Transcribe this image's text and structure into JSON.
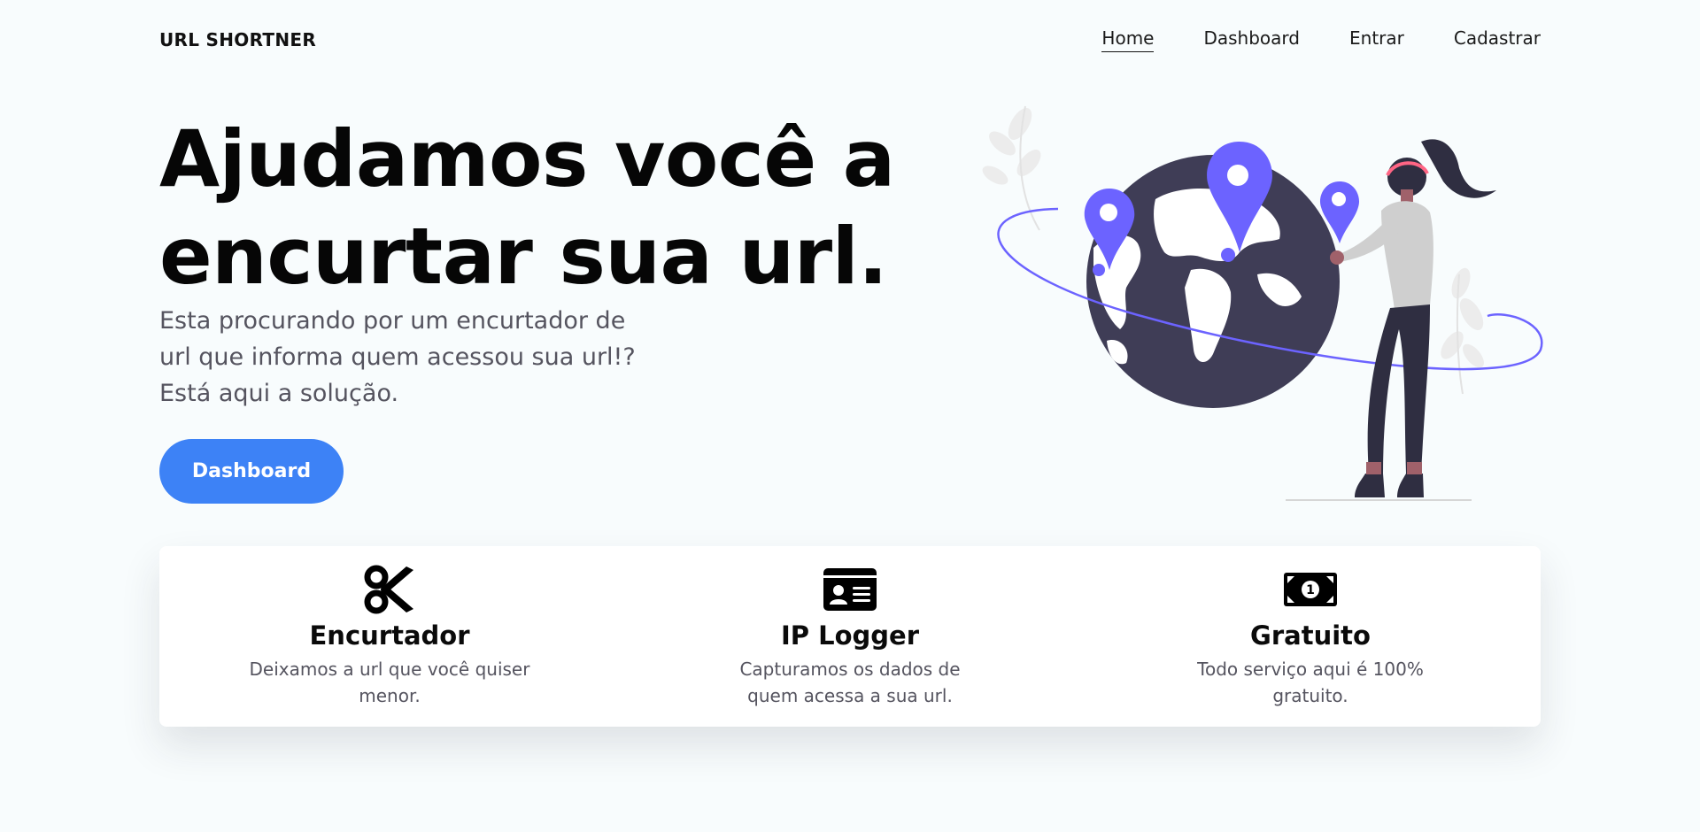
{
  "nav": {
    "brand": "URL SHORTNER",
    "links": [
      {
        "label": "Home",
        "active": true
      },
      {
        "label": "Dashboard"
      },
      {
        "label": "Entrar"
      },
      {
        "label": "Cadastrar"
      }
    ]
  },
  "hero": {
    "title_line1": "Ajudamos você a",
    "title_line2": "encurtar sua url.",
    "sub_line1": "Esta procurando por um encurtador de",
    "sub_line2": "url que informa quem acessou sua url!?",
    "sub_line3": "Está aqui a solução.",
    "cta_label": "Dashboard"
  },
  "features": [
    {
      "icon": "scissors-icon",
      "title": "Encurtador",
      "desc_line1": "Deixamos a url que você quiser",
      "desc_line2": "menor."
    },
    {
      "icon": "id-card-icon",
      "title": "IP Logger",
      "desc_line1": "Capturamos os dados de",
      "desc_line2": "quem acessa a sua url."
    },
    {
      "icon": "money-bill-icon",
      "title": "Gratuito",
      "desc_line1": "Todo serviço aqui é 100%",
      "desc_line2": "gratuito."
    }
  ],
  "colors": {
    "accent": "#3d82f6",
    "illustration_purple": "#6c63ff",
    "globe": "#3f3d56",
    "background": "#f8fcfd"
  }
}
